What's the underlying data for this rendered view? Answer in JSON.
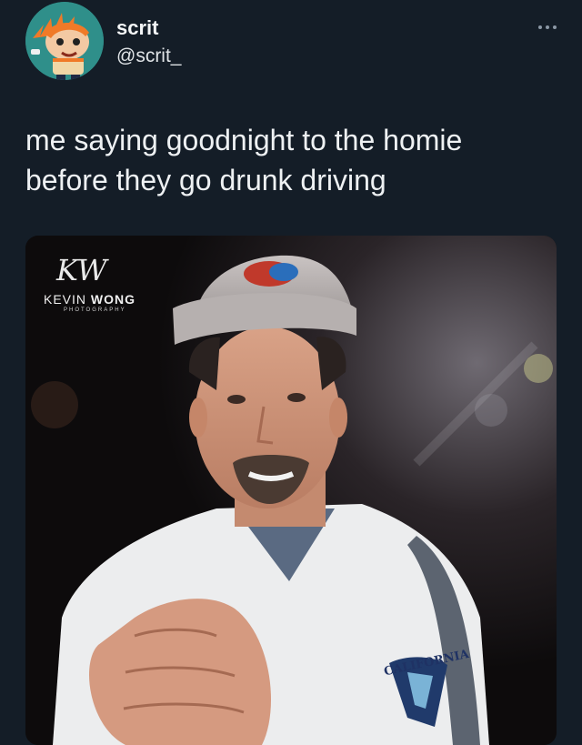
{
  "user": {
    "display_name": "scrit",
    "handle": "@scrit_",
    "avatar_icon": "cartoon-avatar-icon"
  },
  "tweet": {
    "text": "me saying goodnight to the homie\nbefore they go drunk driving"
  },
  "media": {
    "watermark_script": "KW",
    "watermark_first": "KEVIN",
    "watermark_last": "WONG",
    "watermark_sub": "PHOTOGRAPHY",
    "jersey_text": "CALIFORNIA"
  },
  "colors": {
    "background": "#141d27",
    "text": "#e7e9ea",
    "secondary": "#8b98a5"
  }
}
